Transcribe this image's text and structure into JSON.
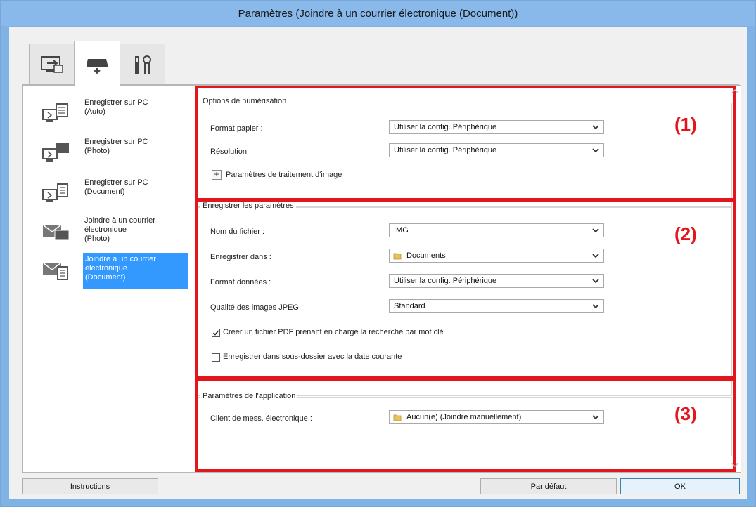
{
  "window": {
    "title": "Paramètres (Joindre à un courrier électronique (Document))"
  },
  "tabs": [
    {
      "icon": "computer-scan-icon",
      "active": false
    },
    {
      "icon": "scanner-icon",
      "active": true
    },
    {
      "icon": "tools-icon",
      "active": false
    }
  ],
  "sidebar": {
    "items": [
      {
        "label": "Enregistrer sur PC\n(Auto)",
        "icon": "save-to-pc-auto-icon"
      },
      {
        "label": "Enregistrer sur PC\n(Photo)",
        "icon": "save-to-pc-photo-icon"
      },
      {
        "label": "Enregistrer sur PC\n(Document)",
        "icon": "save-to-pc-document-icon"
      },
      {
        "label": "Joindre à un courrier\nélectronique\n(Photo)",
        "icon": "email-photo-icon"
      },
      {
        "label": "Joindre à un courrier\nélectronique\n(Document)",
        "icon": "email-document-icon",
        "selected": true
      }
    ]
  },
  "scan_options": {
    "title": "Options de numérisation",
    "paper_size_label": "Format papier :",
    "paper_size_value": "Utiliser la config. Périphérique",
    "resolution_label": "Résolution :",
    "resolution_value": "Utiliser la config. Périphérique",
    "image_processing_label": "Paramètres de traitement d'image",
    "expand_symbol": "+"
  },
  "save_settings": {
    "title": "Enregistrer les paramètres",
    "file_name_label": "Nom du fichier :",
    "file_name_value": "IMG",
    "save_in_label": "Enregistrer dans :",
    "save_in_value": "Documents",
    "data_format_label": "Format données :",
    "data_format_value": "Utiliser la config. Périphérique",
    "jpeg_quality_label": "Qualité des images JPEG :",
    "jpeg_quality_value": "Standard",
    "pdf_keyword_label": "Créer un fichier PDF prenant en charge la recherche par mot clé",
    "pdf_keyword_checked": true,
    "subfolder_label": "Enregistrer dans sous-dossier avec la date courante",
    "subfolder_checked": false
  },
  "app_settings": {
    "title": "Paramètres de l'application",
    "mail_client_label": "Client de mess. électronique :",
    "mail_client_value": "Aucun(e) (Joindre manuellement)"
  },
  "annotations": {
    "one": "(1)",
    "two": "(2)",
    "three": "(3)",
    "color": "#e4161d"
  },
  "footer": {
    "instructions_label": "Instructions",
    "default_label": "Par défaut",
    "ok_label": "OK"
  },
  "colors": {
    "titlebar": "#88b9ea",
    "selection": "#3399ff"
  }
}
